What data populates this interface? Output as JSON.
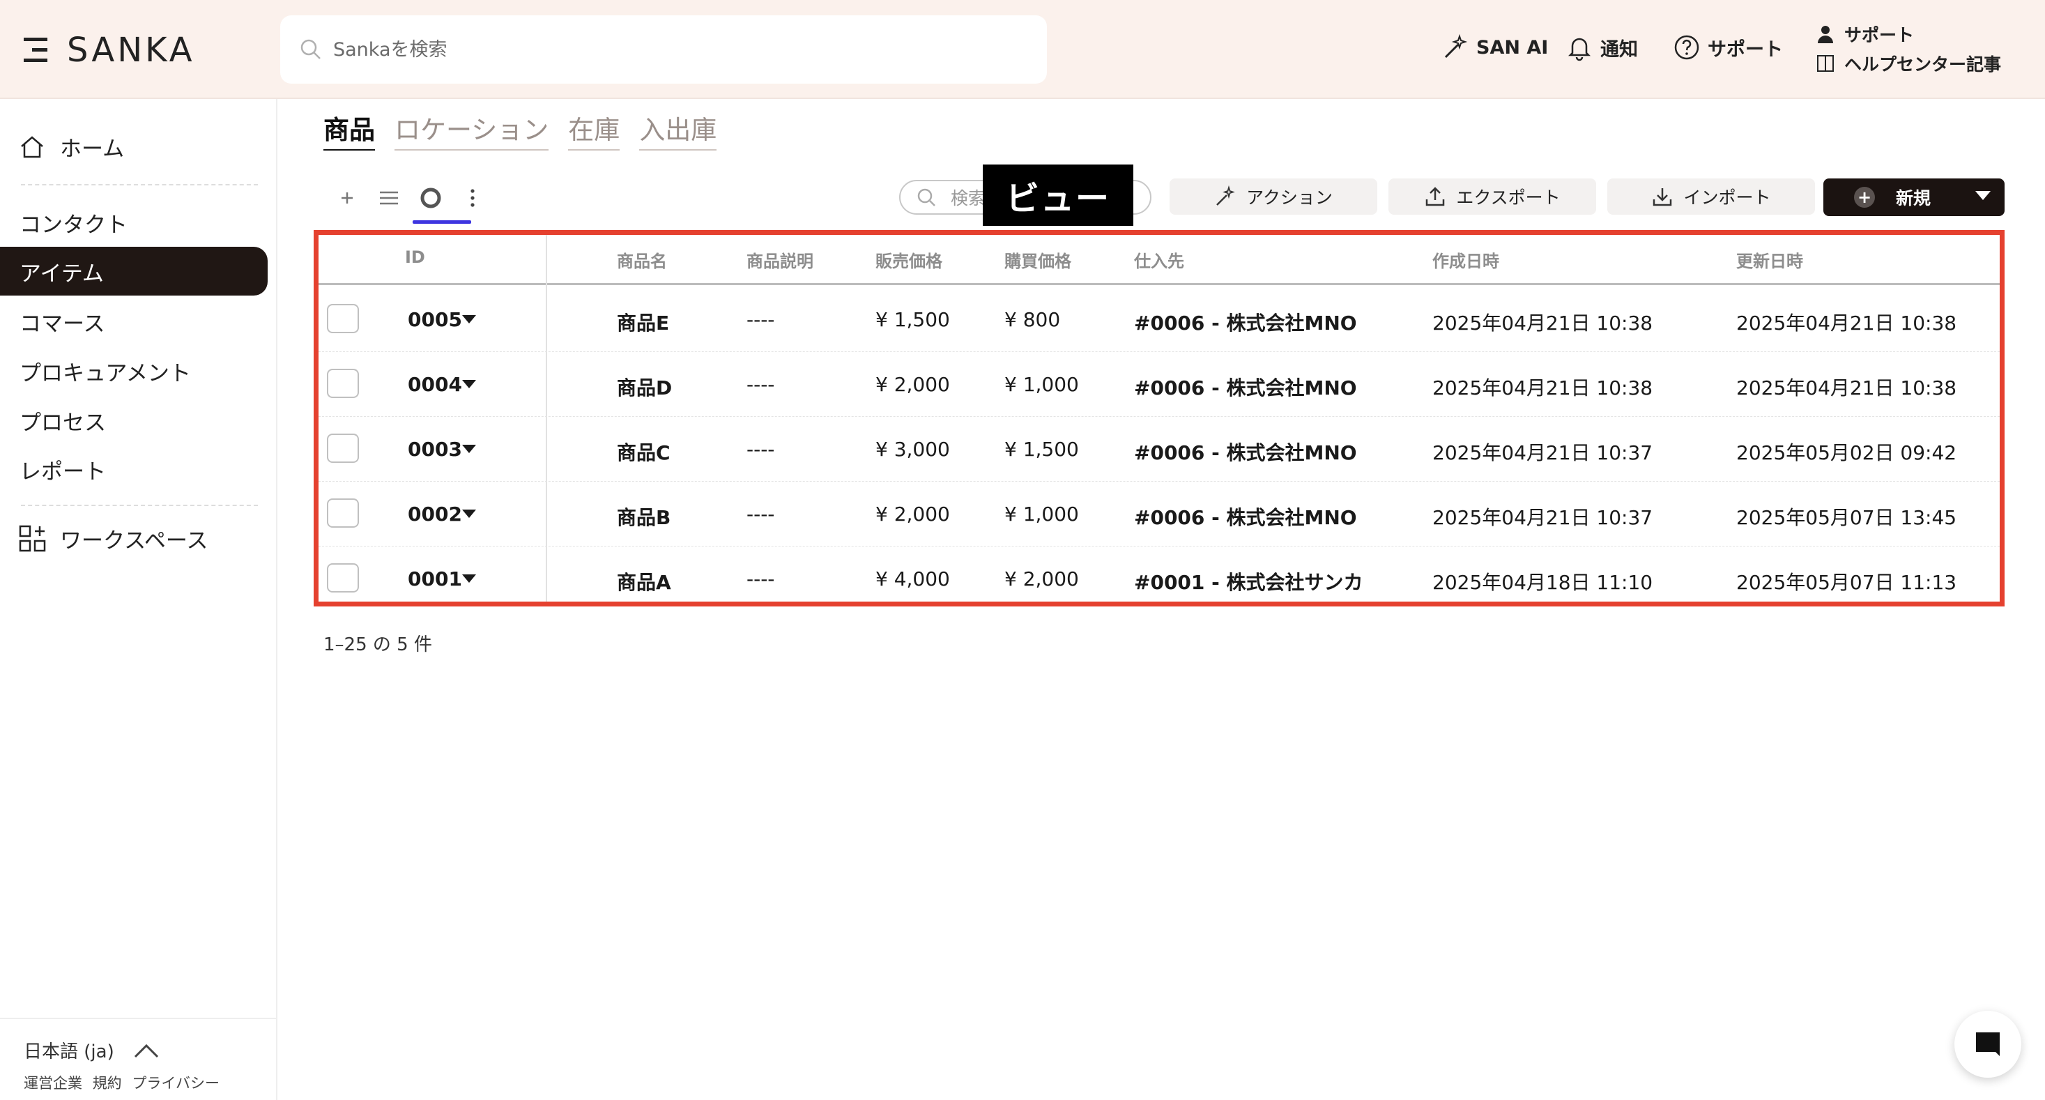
{
  "header": {
    "brand": "SANKA",
    "search_placeholder": "Sankaを検索",
    "san_ai": "SAN AI",
    "notifications": "通知",
    "support": "サポート",
    "support_person": "サポート",
    "help_center": "ヘルプセンター記事"
  },
  "sidebar": {
    "home": "ホーム",
    "items": [
      {
        "label": "コンタクト",
        "active": false
      },
      {
        "label": "アイテム",
        "active": true
      },
      {
        "label": "コマース",
        "active": false
      },
      {
        "label": "プロキュアメント",
        "active": false
      },
      {
        "label": "プロセス",
        "active": false
      },
      {
        "label": "レポート",
        "active": false
      }
    ],
    "workspace": "ワークスペース",
    "language": "日本語 (ja)",
    "footer_links": [
      "運営企業",
      "規約",
      "プライバシー"
    ]
  },
  "tabs": [
    {
      "label": "商品",
      "active": true
    },
    {
      "label": "ロケーション",
      "active": false
    },
    {
      "label": "在庫",
      "active": false
    },
    {
      "label": "入出庫",
      "active": false
    }
  ],
  "toolbar": {
    "search_placeholder": "検索",
    "tooltip": "ビュー",
    "action": "アクション",
    "export": "エクスポート",
    "import": "インポート",
    "new": "新規"
  },
  "table": {
    "columns": [
      "ID",
      "商品名",
      "商品説明",
      "販売価格",
      "購買価格",
      "仕入先",
      "作成日時",
      "更新日時"
    ],
    "rows": [
      {
        "id": "0005",
        "name": "商品E",
        "desc": "----",
        "sale": "¥ 1,500",
        "cost": "¥ 800",
        "supplier": "#0006 - 株式会社MNO",
        "created": "2025年04月21日 10:38",
        "updated": "2025年04月21日 10:38"
      },
      {
        "id": "0004",
        "name": "商品D",
        "desc": "----",
        "sale": "¥ 2,000",
        "cost": "¥ 1,000",
        "supplier": "#0006 - 株式会社MNO",
        "created": "2025年04月21日 10:38",
        "updated": "2025年04月21日 10:38"
      },
      {
        "id": "0003",
        "name": "商品C",
        "desc": "----",
        "sale": "¥ 3,000",
        "cost": "¥ 1,500",
        "supplier": "#0006 - 株式会社MNO",
        "created": "2025年04月21日 10:37",
        "updated": "2025年05月02日 09:42"
      },
      {
        "id": "0002",
        "name": "商品B",
        "desc": "----",
        "sale": "¥ 2,000",
        "cost": "¥ 1,000",
        "supplier": "#0006 - 株式会社MNO",
        "created": "2025年04月21日 10:37",
        "updated": "2025年05月07日 13:45"
      },
      {
        "id": "0001",
        "name": "商品A",
        "desc": "----",
        "sale": "¥ 4,000",
        "cost": "¥ 2,000",
        "supplier": "#0001 - 株式会社サンカ",
        "created": "2025年04月18日 11:10",
        "updated": "2025年05月07日 11:13"
      }
    ]
  },
  "pagination": "1–25 の 5 件",
  "colors": {
    "header_bg": "#fbf1ec",
    "active_nav": "#201714",
    "highlight_frame": "#e5412f",
    "view_underline": "#3d35e0",
    "new_button": "#1b1311"
  }
}
